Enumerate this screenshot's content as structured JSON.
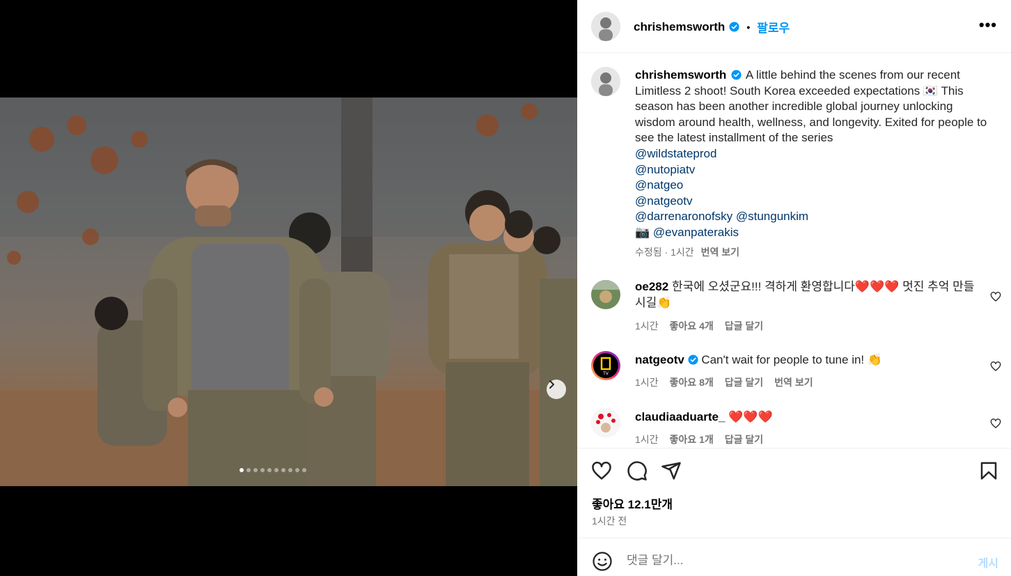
{
  "post": {
    "username": "chrishemsworth",
    "follow_label": "팔로우",
    "more_label": "•••",
    "separator": "•"
  },
  "caption": {
    "username": "chrishemsworth",
    "text": "A little behind the scenes from our recent Limitless 2 shoot! South Korea exceeded expectations 🇰🇷 This season has been another incredible global journey unlocking wisdom around health, wellness, and longevity. Exited for people to see the latest installment of the series",
    "mentions": [
      "@wildstateprod",
      "@nutopiatv",
      "@natgeo",
      "@natgeotv"
    ],
    "mention_line": [
      "@darrenaronofsky",
      "@stungunkim"
    ],
    "camera_emoji": "📷",
    "photo_credit": "@evanpaterakis",
    "edited_label": "수정됨 · 1시간",
    "translate_label": "번역 보기"
  },
  "comments": [
    {
      "username": "oe282",
      "text": "한국에 오셨군요!!! 격하게 환영합니다❤️❤️❤️ 멋진 추억 만들시길👏",
      "time": "1시간",
      "likes": "좋아요 4개",
      "reply": "답글 달기",
      "translate": ""
    },
    {
      "username": "natgeotv",
      "text": "Can't wait for people to tune in! 👏",
      "time": "1시간",
      "likes": "좋아요 8개",
      "reply": "답글 달기",
      "translate": "번역 보기"
    },
    {
      "username": "claudiaaduarte_",
      "text": "❤️❤️❤️",
      "time": "1시간",
      "likes": "좋아요 1개",
      "reply": "답글 달기",
      "translate": ""
    }
  ],
  "engagement": {
    "likes": "좋아요 12.1만개",
    "time_ago": "1시간 전"
  },
  "composer": {
    "placeholder": "댓글 달기...",
    "post_label": "게시"
  },
  "carousel": {
    "total": 10,
    "current": 1
  },
  "colors": {
    "link": "#00376b",
    "accent": "#0095f6",
    "verified": "#0095f6",
    "muted": "#737373"
  }
}
